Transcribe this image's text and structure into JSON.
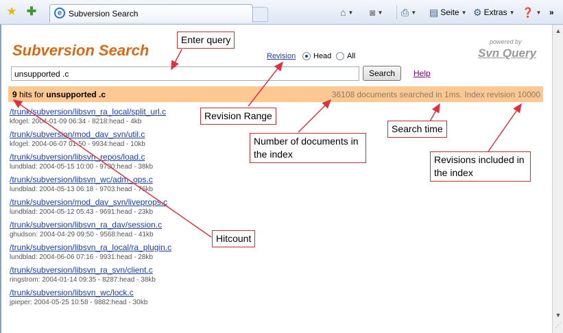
{
  "browser": {
    "tab_title": "Subversion Search",
    "commands": {
      "page": "Seite",
      "tools": "Extras"
    }
  },
  "page": {
    "logo": "Subversion Search",
    "powered_by": "powered by",
    "brand": "Svn Query",
    "revision_label": "Revision",
    "radio_head": "Head",
    "radio_all": "All",
    "selected_revision": "Head",
    "query": "unsupported .c",
    "search_button": "Search",
    "help": "Help",
    "hits_count": "9",
    "hits_text": " hits for ",
    "hits_query": "unsupported .c",
    "stats": "36108 documents searched in 1ms. Index revision 10000"
  },
  "results": [
    {
      "path": "/trunk/subversion/libsvn_ra_local/split_url.c",
      "meta": "kfogel:  2004-01-09 06:34  -  8218:head  -  4kb"
    },
    {
      "path": "/trunk/subversion/mod_dav_svn/util.c",
      "meta": "kfogel:  2004-06-07 01:50  -  9934:head  -  10kb"
    },
    {
      "path": "/trunk/subversion/libsvn_repos/load.c",
      "meta": "lundblad:  2004-05-15 10:00  -  9730:head  -  38kb"
    },
    {
      "path": "/trunk/subversion/libsvn_wc/adm_ops.c",
      "meta": "lundblad:  2004-05-13 06:18  -  9703:head  -  76kb"
    },
    {
      "path": "/trunk/subversion/mod_dav_svn/liveprops.c",
      "meta": "lundblad:  2004-05-12 05:43  -  9691:head  -  23kb"
    },
    {
      "path": "/trunk/subversion/libsvn_ra_dav/session.c",
      "meta": "ghudson:  2004-04-29 09:50  -  9568:head  -  41kb"
    },
    {
      "path": "/trunk/subversion/libsvn_ra_local/ra_plugin.c",
      "meta": "lundblad:  2004-06-06 07:16  -  9931:head  -  28kb"
    },
    {
      "path": "/trunk/subversion/libsvn_ra_svn/client.c",
      "meta": "ringstrom:  2004-01-14 09:35  -  8287:head  -  38kb"
    },
    {
      "path": "/trunk/subversion/libsvn_wc/lock.c",
      "meta": "jpieper:  2004-05-25 10:58  -  9882:head  -  30kb"
    }
  ],
  "annotations": {
    "enter_query": "Enter query",
    "revision_range": "Revision Range",
    "documents": "Number of documents in the index",
    "search_time": "Search time",
    "revisions": "Revisions included in the index",
    "hitcount": "Hitcount"
  },
  "colors": {
    "logo": "#d46a18",
    "hits_bar": "#fdc891",
    "link": "#1a3fa0",
    "visited_link": "#7a007a",
    "callout_border": "#c03030",
    "arrow": "#e03040"
  },
  "icons": {
    "favorites": "star-icon",
    "add_favorites": "add-favorite-icon",
    "tab": "ie-icon",
    "home": "home-icon",
    "feeds": "rss-icon",
    "print": "printer-icon",
    "page": "page-icon",
    "tools": "gear-icon",
    "help": "help-icon"
  }
}
